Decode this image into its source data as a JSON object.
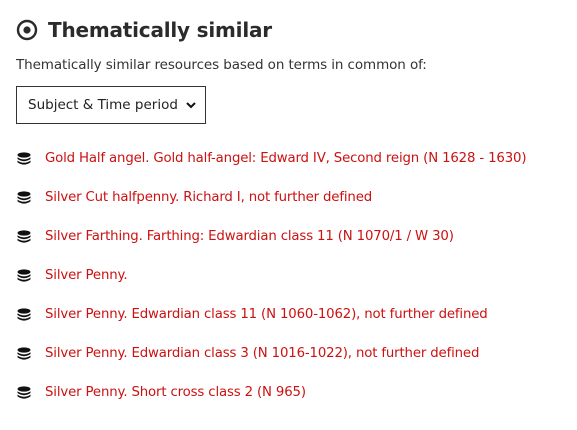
{
  "section": {
    "icon": "target-icon",
    "title": "Thematically similar",
    "description": "Thematically similar resources based on terms in common of:"
  },
  "filter": {
    "selected": "Subject & Time period",
    "icon": "chevron-down-icon"
  },
  "results": [
    {
      "icon": "coins-icon",
      "label": "Gold Half angel. Gold half-angel: Edward IV, Second reign (N 1628 - 1630)"
    },
    {
      "icon": "coins-icon",
      "label": "Silver Cut halfpenny. Richard I, not further defined"
    },
    {
      "icon": "coins-icon",
      "label": "Silver Farthing. Farthing: Edwardian class 11 (N 1070/1 / W 30)"
    },
    {
      "icon": "coins-icon",
      "label": "Silver Penny."
    },
    {
      "icon": "coins-icon",
      "label": "Silver Penny. Edwardian class 11 (N 1060-1062), not further defined"
    },
    {
      "icon": "coins-icon",
      "label": "Silver Penny. Edwardian class 3 (N 1016-1022), not further defined"
    },
    {
      "icon": "coins-icon",
      "label": "Silver Penny. Short cross class 2 (N 965)"
    }
  ],
  "colors": {
    "link": "#cc1111",
    "text": "#222222"
  }
}
